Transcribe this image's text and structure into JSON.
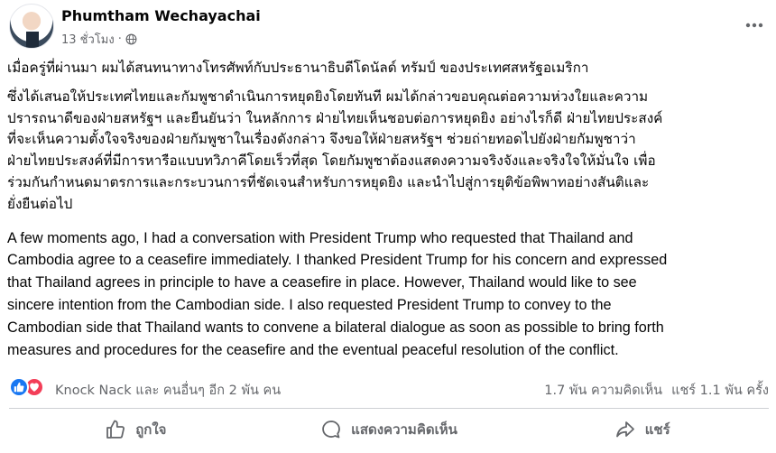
{
  "post": {
    "author": "Phumtham Wechayachai",
    "time": "13 ชั่วโมง",
    "separator": "·",
    "privacy_icon": "globe-icon",
    "more_icon": "more-dots-icon"
  },
  "content": {
    "thai_intro": "เมื่อครู่ที่ผ่านมา ผมได้สนทนาทางโทรศัพท์กับประธานาธิบดีโดนัลด์ ทรัมป์ ของประเทศสหรัฐอเมริกา",
    "thai_body": "ซึ่งได้เสนอให้ประเทศไทยและกัมพูชาดำเนินการหยุดยิงโดยทันที ผมได้กล่าวขอบคุณต่อความห่วงใยและความ\nปรารถนาดีของฝ่ายสหรัฐฯ และยืนยันว่า ในหลักการ ฝ่ายไทยเห็นชอบต่อการหยุดยิง อย่างไรก็ดี ฝ่ายไทยประสงค์\nที่จะเห็นความตั้งใจจริงของฝ่ายกัมพูชาในเรื่องดังกล่าว จึงขอให้ฝ่ายสหรัฐฯ ช่วยถ่ายทอดไปยังฝ่ายกัมพูชาว่า\nฝ่ายไทยประสงค์ที่มีการหารือแบบทวิภาคีโดยเร็วที่สุด โดยกัมพูชาต้องแสดงความจริงจังและจริงใจให้มั่นใจ เพื่อ\nร่วมกันกำหนดมาตรการและกระบวนการที่ชัดเจนสำหรับการหยุดยิง และนำไปสู่การยุติข้อพิพาทอย่างสันติและ\nยั่งยืนต่อไป",
    "english": "A few moments ago, I had a conversation with President Trump who requested that Thailand and\nCambodia agree to a ceasefire immediately. I thanked President Trump for his concern and expressed\nthat Thailand agrees in principle to have a ceasefire in place. However, Thailand would like to see\nsincere intention from the Cambodian side. I also requested President Trump to convey to the\nCambodian side that Thailand wants to convene a bilateral dialogue as soon as possible to bring forth\nmeasures and procedures for the ceasefire and the eventual peaceful resolution of the conflict."
  },
  "stats": {
    "reactions": [
      "like",
      "love"
    ],
    "reactors_text": "Knock Nack และ คนอื่นๆ อีก 2 พัน คน",
    "comments_text": "1.7 พัน ความคิดเห็น",
    "shares_text": "แชร์ 1.1 พัน ครั้ง"
  },
  "actions": {
    "like_label": "ถูกใจ",
    "comment_label": "แสดงความคิดเห็น",
    "share_label": "แชร์"
  },
  "colors": {
    "text_primary": "#050505",
    "text_secondary": "#65676b",
    "like_blue": "#1877f2",
    "love_red": "#f33e58",
    "divider": "#ced0d4"
  }
}
